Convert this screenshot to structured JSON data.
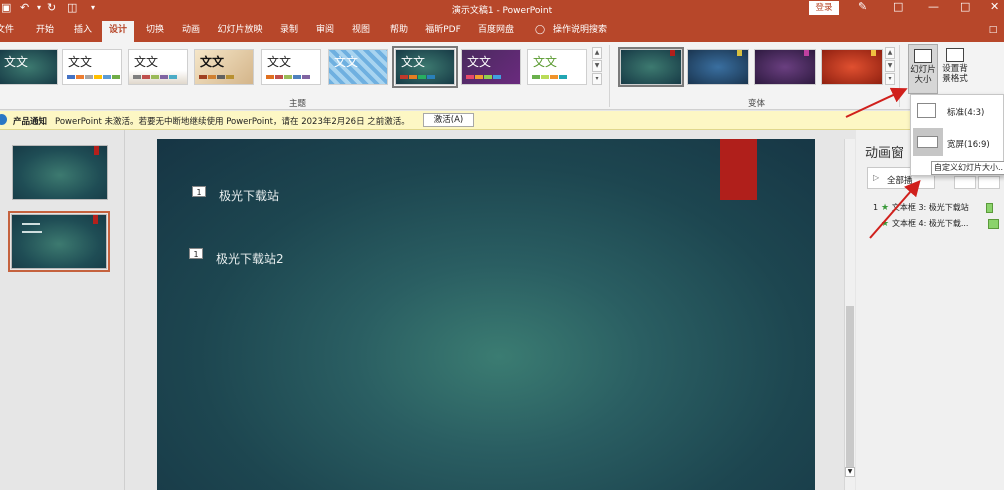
{
  "titlebar": {
    "doc_title": "演示文稿1  -  PowerPoint",
    "login_label": "登录",
    "file_label": "文件"
  },
  "tabs": [
    {
      "label": "开始"
    },
    {
      "label": "插入"
    },
    {
      "label": "设计",
      "active": true
    },
    {
      "label": "切换"
    },
    {
      "label": "动画"
    },
    {
      "label": "幻灯片放映"
    },
    {
      "label": "录制"
    },
    {
      "label": "审阅"
    },
    {
      "label": "视图"
    },
    {
      "label": "帮助"
    },
    {
      "label": "福昕PDF"
    },
    {
      "label": "百度网盘"
    }
  ],
  "tell_me": "操作说明搜索",
  "ribbon": {
    "theme_text": "文文",
    "theme_text_alt": "文文",
    "themes_group_label": "主题",
    "variants_group_label": "变体",
    "slide_size_label_1": "幻灯片",
    "slide_size_label_2": "大小",
    "format_bg_label_1": "设置背",
    "format_bg_label_2": "景格式"
  },
  "notice": {
    "title": "产品通知",
    "message": "PowerPoint 未激活。若要无中断地继续使用 PowerPoint，请在 2023年2月26日 之前激活。",
    "button": "激活(A)"
  },
  "slide": {
    "tag1": "1",
    "text1": "极光下载站",
    "tag2": "1",
    "text2": "极光下载站2"
  },
  "anim_pane": {
    "title": "动画窗",
    "play_all": "全部播",
    "items": [
      {
        "num": "1",
        "label": "文本框 3: 极光下载站"
      },
      {
        "num": "",
        "label": "文本框 4: 极光下载..."
      }
    ]
  },
  "dropdown": {
    "standard": "标准(4:3)",
    "widescreen": "宽屏(16:9)",
    "custom": "自定义幻灯片大小..."
  },
  "colors": {
    "accent": "#b7472a",
    "slide_dark": "#163544",
    "slide_light": "#3b7c72",
    "red_bar": "#b01f1b",
    "arrow": "#d0201c"
  }
}
